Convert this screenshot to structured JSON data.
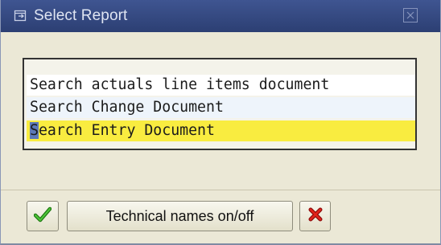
{
  "dialog": {
    "title": "Select Report",
    "close_icon": "close-icon"
  },
  "report_list": {
    "items": [
      {
        "label": "Search actuals line items document",
        "state": "normal"
      },
      {
        "label": "Search Change Document",
        "state": "normal"
      },
      {
        "label": "Search Entry Document",
        "state": "selected",
        "first_char": "S",
        "rest": "earch Entry Document"
      }
    ]
  },
  "toolbar": {
    "ok_icon": "green-checkmark-icon",
    "technical_names_label": "Technical names on/off",
    "cancel_icon": "red-x-icon"
  },
  "colors": {
    "title_bar": "#2c3f73",
    "selection_highlight": "#f9ec40",
    "dialog_background": "#ebe8d6"
  }
}
